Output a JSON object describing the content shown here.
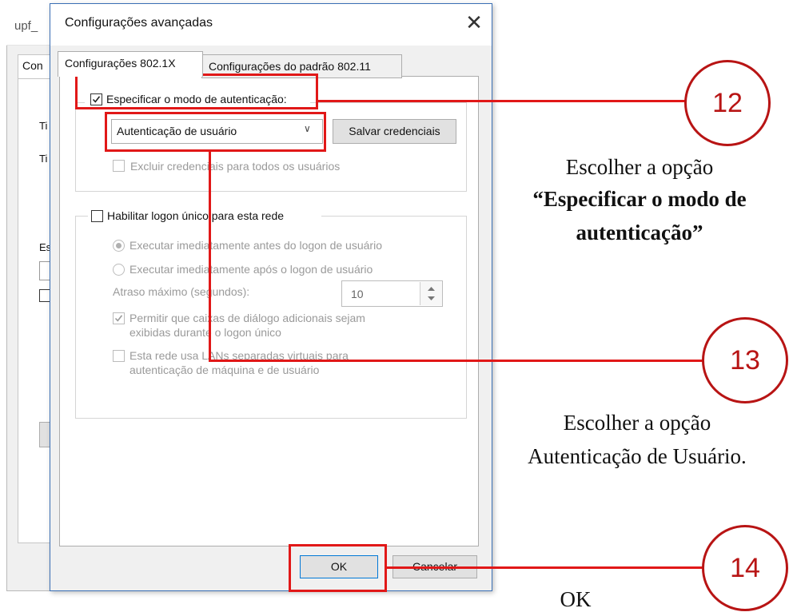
{
  "background_window": {
    "title_fragment": "upf_",
    "tab_fragment": "Con",
    "label_fragments": [
      "Ti",
      "Ti",
      "Es"
    ]
  },
  "dialog": {
    "title": "Configurações avançadas",
    "close_glyph": "✕",
    "tabs": [
      {
        "label": "Configurações 802.1X",
        "active": true
      },
      {
        "label": "Configurações do padrão 802.11",
        "active": false
      }
    ],
    "specify_auth_mode": {
      "label": "Especificar o modo de autenticação:",
      "checked": true
    },
    "auth_mode_select": {
      "value": "Autenticação de usuário",
      "arrow": "∨"
    },
    "save_credentials_button": "Salvar credenciais",
    "delete_credentials": {
      "label": "Excluir credenciais para todos os usuários",
      "checked": false,
      "disabled": true
    },
    "single_signon": {
      "label": "Habilitar logon único para esta rede",
      "checked": false
    },
    "radio_before": {
      "label": "Executar imediatamente antes do logon de usuário",
      "selected": true
    },
    "radio_after": {
      "label": "Executar imediatamente após o logon de usuário",
      "selected": false
    },
    "max_delay": {
      "label": "Atraso máximo (segundos):",
      "value": "10"
    },
    "allow_dialogs": {
      "line1": "Permitir que caixas de diálogo adicionais sejam",
      "line2": "exibidas durante o logon único",
      "checked": true
    },
    "vlan": {
      "line1": "Esta rede usa LANs separadas virtuais para",
      "line2": "autenticação de máquina e de usuário",
      "checked": false
    },
    "ok_button": "OK",
    "cancel_button": "Cancelar"
  },
  "annotations": [
    {
      "number": "12",
      "line1": "Escolher a opção",
      "line2": "“Especificar o modo de",
      "line3": "autenticação”"
    },
    {
      "number": "13",
      "line1": "Escolher a opção",
      "line2": "Autenticação de Usuário."
    },
    {
      "number": "14",
      "line1": "OK"
    }
  ],
  "colors": {
    "annotation_red": "#e11818",
    "circle_red": "#b81414",
    "dialog_border": "#3a6fb5"
  }
}
